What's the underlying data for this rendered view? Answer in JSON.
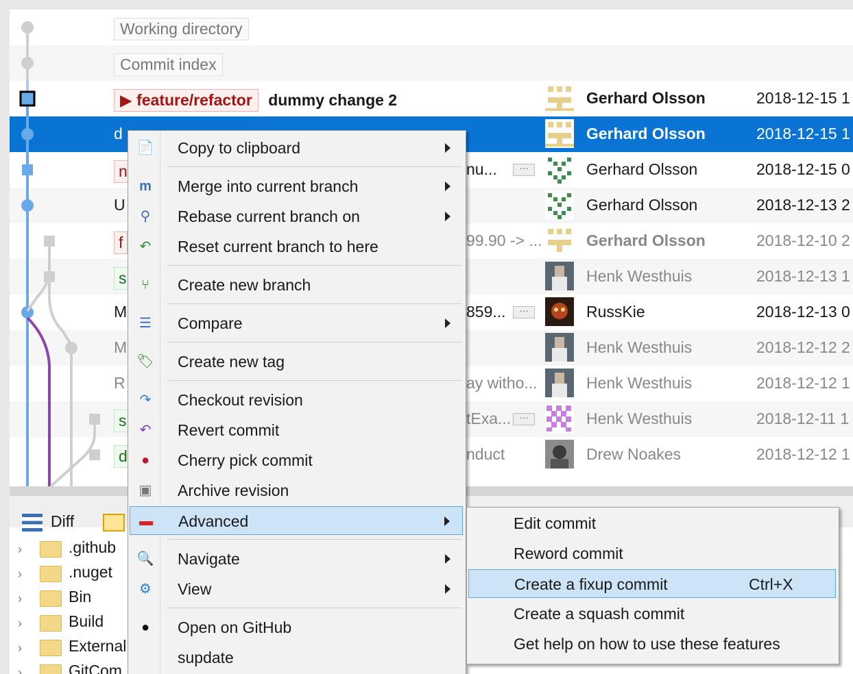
{
  "revision_grid": {
    "rows": [
      {
        "ref": "Working directory",
        "message": "",
        "author": "",
        "date": ""
      },
      {
        "ref": "Commit index",
        "message": "",
        "author": "",
        "date": ""
      },
      {
        "branch": "feature/refactor",
        "message": "dummy change 2",
        "author": "Gerhard Olsson",
        "date": "2018-12-15 1"
      },
      {
        "prefix": "d",
        "message": "",
        "author": "Gerhard Olsson",
        "date": "2018-12-15 1"
      },
      {
        "prefix": "n",
        "tail": "nu...",
        "author": "Gerhard Olsson",
        "date": "2018-12-15 0"
      },
      {
        "prefix": "U",
        "tail": "",
        "author": "Gerhard Olsson",
        "date": "2018-12-13 2"
      },
      {
        "prefix": "f",
        "tail": "99.90 -> ...",
        "author": "Gerhard Olsson",
        "date": "2018-12-10 2"
      },
      {
        "prefix": "s",
        "tail": "",
        "author": "Henk Westhuis",
        "date": "2018-12-13 1"
      },
      {
        "prefix": "M",
        "tail": "859...",
        "author": "RussKie",
        "date": "2018-12-13 0"
      },
      {
        "prefix": "M",
        "tail": "",
        "author": "Henk Westhuis",
        "date": "2018-12-12 2"
      },
      {
        "prefix": "R",
        "tail": "ay witho...",
        "author": "Henk Westhuis",
        "date": "2018-12-12 1"
      },
      {
        "prefix": "s",
        "tail": "tExa...",
        "author": "Henk Westhuis",
        "date": "2018-12-11 1"
      },
      {
        "prefix": "d",
        "tail": "nduct",
        "author": "Drew Noakes",
        "date": "2018-12-12 1"
      }
    ],
    "more_label": "···"
  },
  "bottom_tabs": {
    "diff": "Diff"
  },
  "file_tree": [
    ".github",
    ".nuget",
    "Bin",
    "Build",
    "External",
    "GitCom"
  ],
  "context_menu": {
    "items": [
      {
        "label": "Copy to clipboard",
        "icon": "copy-icon",
        "submenu": true
      },
      {
        "label": "Merge into current branch",
        "icon": "merge-icon",
        "submenu": true
      },
      {
        "label": "Rebase current branch on",
        "icon": "rebase-icon",
        "submenu": true
      },
      {
        "label": "Reset current branch to here",
        "icon": "reset-icon",
        "submenu": false
      },
      {
        "label": "Create new branch",
        "icon": "branch-add-icon",
        "submenu": false
      },
      {
        "label": "Compare",
        "icon": "compare-icon",
        "submenu": true
      },
      {
        "label": "Create new tag",
        "icon": "tag-add-icon",
        "submenu": false
      },
      {
        "label": "Checkout revision",
        "icon": "checkout-icon",
        "submenu": false
      },
      {
        "label": "Revert commit",
        "icon": "revert-icon",
        "submenu": false
      },
      {
        "label": "Cherry pick commit",
        "icon": "cherry-icon",
        "submenu": false
      },
      {
        "label": "Archive revision",
        "icon": "archive-icon",
        "submenu": false
      },
      {
        "label": "Advanced",
        "icon": "toolbox-icon",
        "submenu": true
      },
      {
        "label": "Navigate",
        "icon": "navigate-icon",
        "submenu": true
      },
      {
        "label": "View",
        "icon": "view-icon",
        "submenu": true
      },
      {
        "label": "Open on GitHub",
        "icon": "github-icon",
        "submenu": false
      },
      {
        "label": "supdate",
        "icon": "",
        "submenu": false
      }
    ]
  },
  "advanced_submenu": {
    "items": [
      {
        "label": "Edit commit",
        "shortcut": ""
      },
      {
        "label": "Reword commit",
        "shortcut": ""
      },
      {
        "label": "Create a fixup commit",
        "shortcut": "Ctrl+X"
      },
      {
        "label": "Create a squash commit",
        "shortcut": ""
      },
      {
        "label": "Get help on how to use these features",
        "shortcut": ""
      }
    ]
  },
  "colors": {
    "selection": "#0a74d4",
    "menu_highlight": "#cde4f7",
    "graph_main": "#6aa9e8",
    "graph_purple": "#8e44ad"
  }
}
